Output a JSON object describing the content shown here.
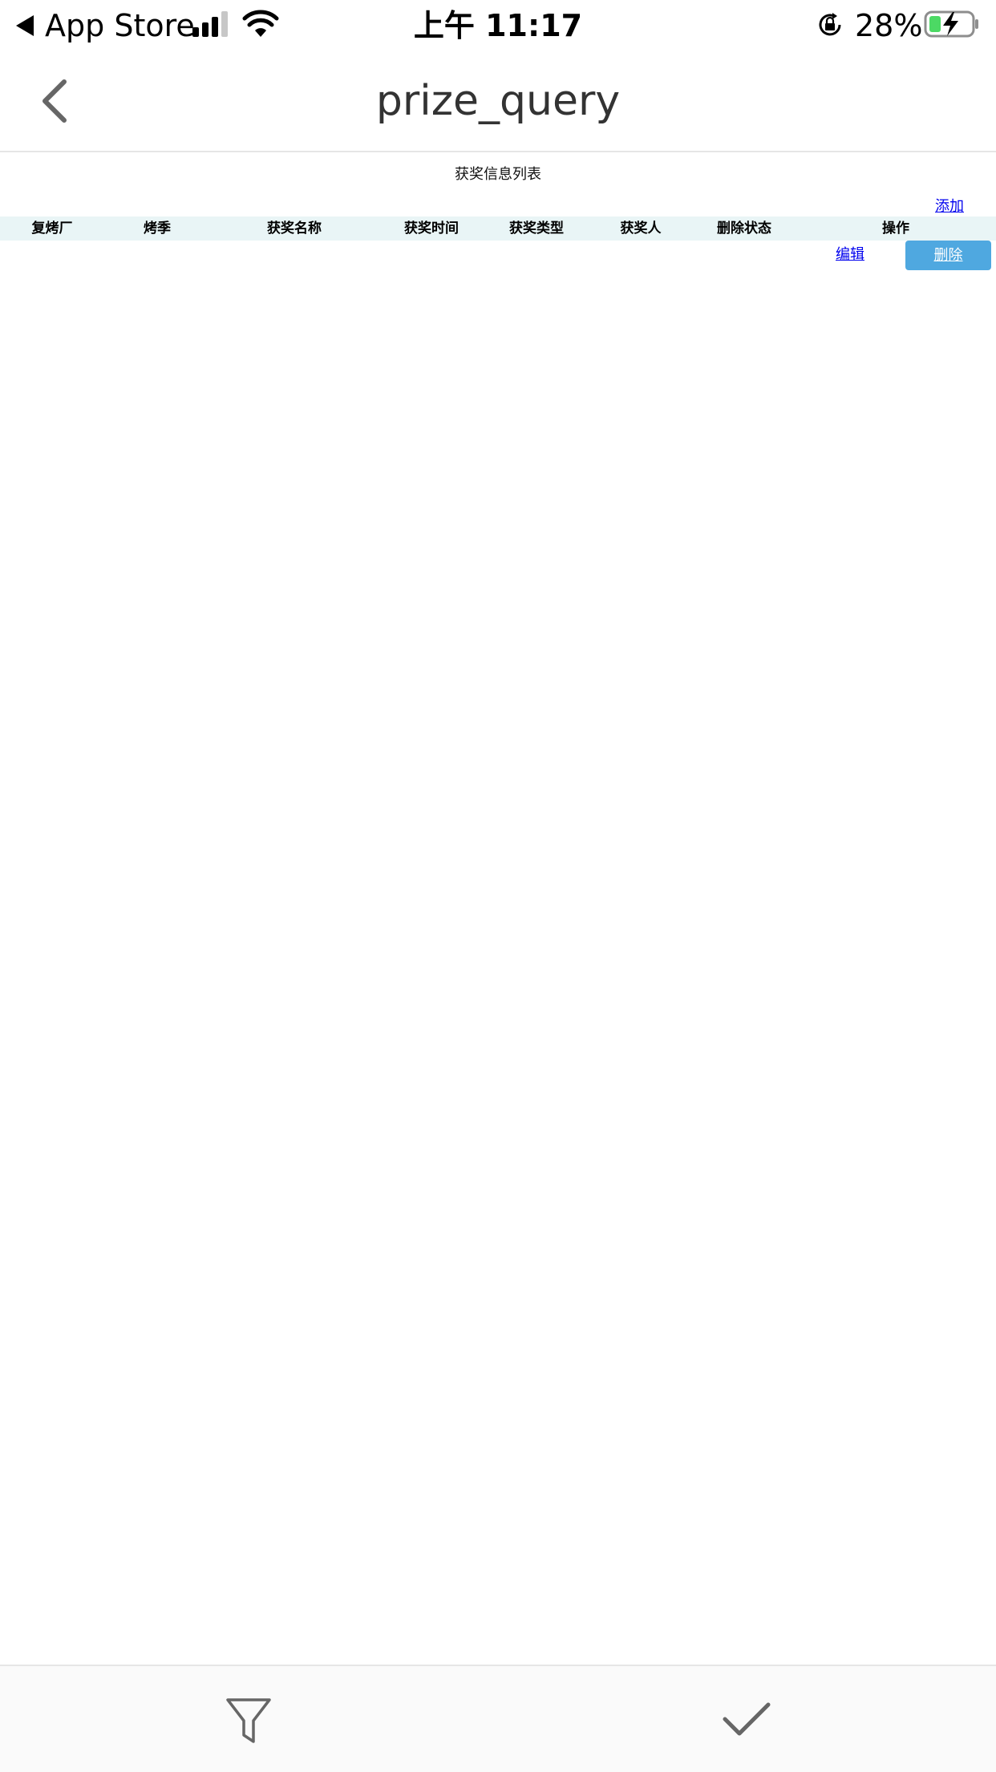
{
  "status_bar": {
    "back_app": "App Store",
    "time": "上午 11:17",
    "battery": "28%",
    "icons": [
      "back-triangle-icon",
      "signal-icon",
      "wifi-icon",
      "rotation-lock-icon",
      "battery-charging-icon"
    ],
    "battery_fill_fraction": 0.28,
    "battery_color": "#4cd964",
    "signal_bars_active": 3,
    "signal_bars_total": 4
  },
  "nav": {
    "title": "prize_query",
    "back_icon": "chevron-left-icon"
  },
  "content": {
    "list_title": "获奖信息列表",
    "add_label": "添加",
    "table": {
      "columns": [
        "复烤厂",
        "烤季",
        "获奖名称",
        "获奖时间",
        "获奖类型",
        "获奖人",
        "删除状态",
        "操作"
      ],
      "header_bg": "#e9f5f6",
      "rows": [
        {
          "cells": [
            "",
            "",
            "",
            "",
            "",
            "",
            "",
            ""
          ],
          "actions": {
            "edit_label": "编辑",
            "delete_label": "删除"
          }
        }
      ]
    },
    "accent_color": "#4fa8e0",
    "link_color": "#0000ee"
  },
  "bottom_bar": {
    "icons": [
      "filter-icon",
      "checkmark-icon"
    ]
  }
}
